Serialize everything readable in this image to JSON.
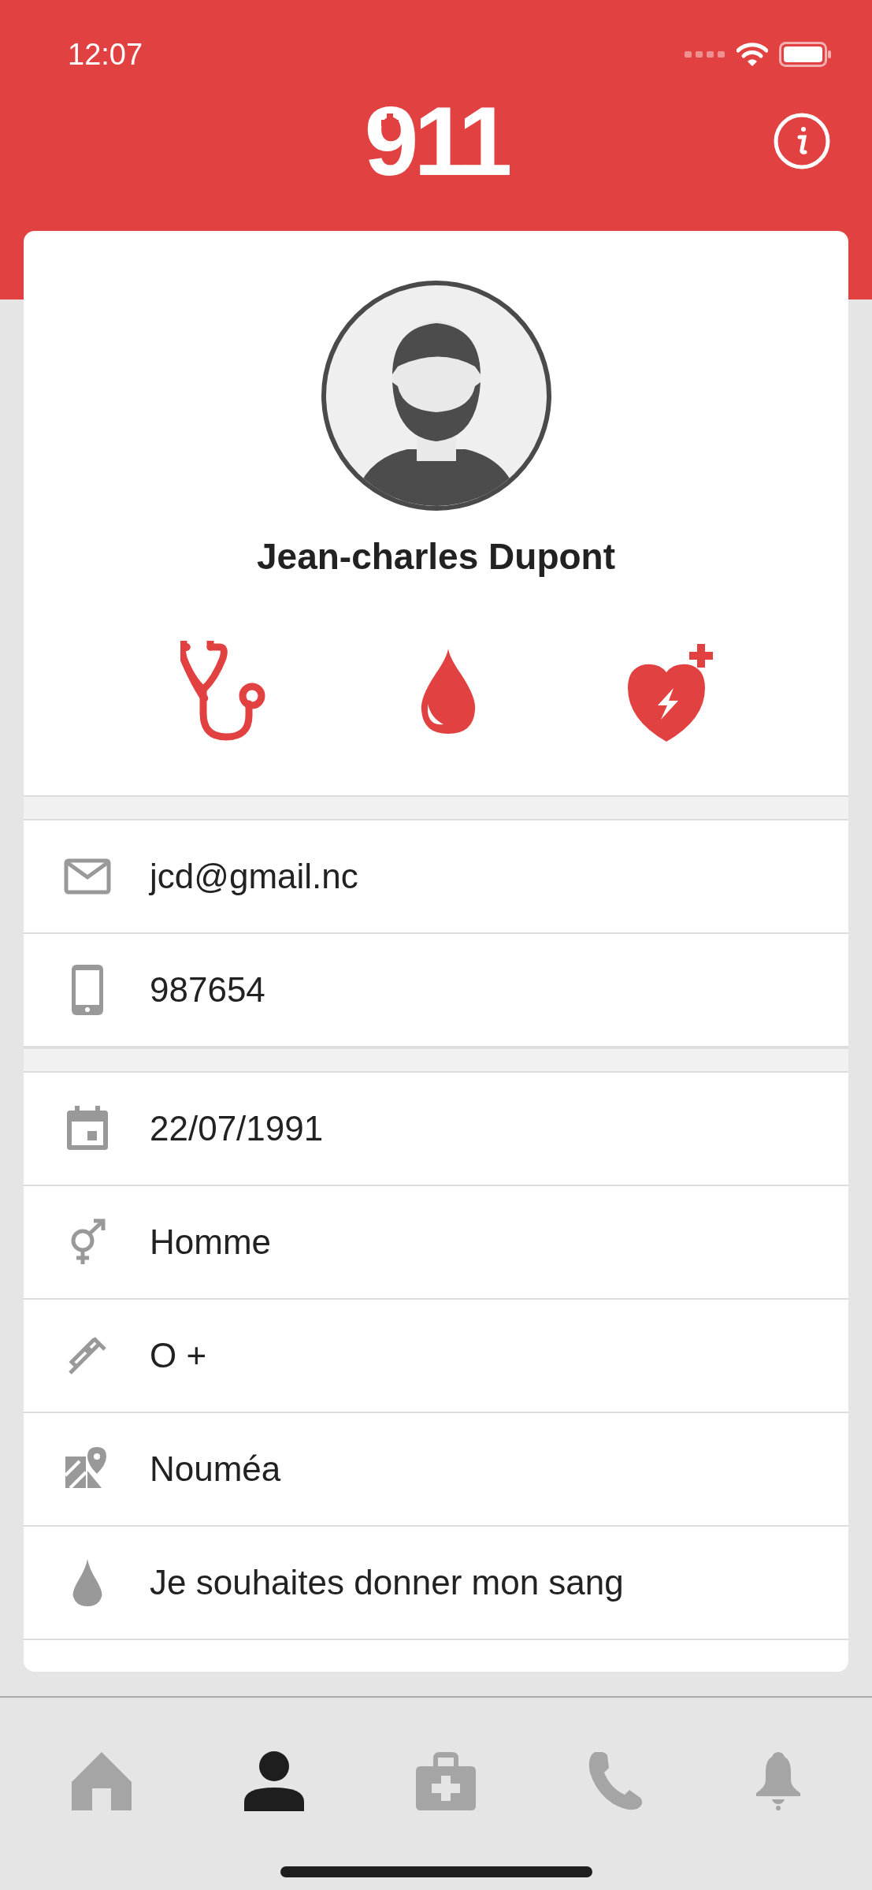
{
  "status_bar": {
    "time": "12:07"
  },
  "header": {
    "title": "911"
  },
  "profile": {
    "name": "Jean-charles Dupont"
  },
  "info_groups": [
    {
      "rows": [
        {
          "kind": "email",
          "text": "jcd@gmail.nc"
        },
        {
          "kind": "phone",
          "text": "987654"
        }
      ]
    },
    {
      "rows": [
        {
          "kind": "date",
          "text": "22/07/1991"
        },
        {
          "kind": "gender",
          "text": "Homme"
        },
        {
          "kind": "blood",
          "text": "O +"
        },
        {
          "kind": "place",
          "text": "Nouméa"
        },
        {
          "kind": "donor",
          "text": "Je souhaites donner mon sang"
        }
      ]
    }
  ],
  "tab_bar": [
    {
      "kind": "home",
      "selected": false
    },
    {
      "kind": "profile",
      "selected": true
    },
    {
      "kind": "medical",
      "selected": false
    },
    {
      "kind": "phone",
      "selected": false
    },
    {
      "kind": "alerts",
      "selected": false
    }
  ]
}
